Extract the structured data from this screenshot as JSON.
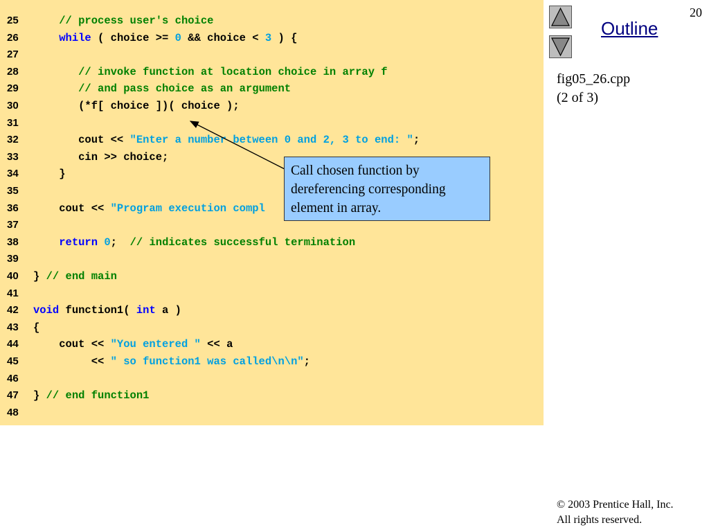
{
  "slide": {
    "page_number": "20",
    "outline_label": "Outline",
    "file_name": "fig05_26.cpp",
    "part": "(2 of 3)",
    "copyright_symbol": "©",
    "copyright_line1": " 2003 Prentice Hall, Inc.",
    "copyright_line2": "All rights reserved.",
    "nav_up_icon": "triangle-up-icon",
    "nav_down_icon": "triangle-down-icon"
  },
  "callout": {
    "text": "Call chosen function by dereferencing corresponding element in array."
  },
  "colors": {
    "code_background": "#ffe599",
    "keyword": "#0000ff",
    "comment": "#008000",
    "string": "#00a0e0",
    "callout_background": "#99ccff",
    "outline_link": "#000080"
  },
  "code_lines": [
    {
      "num": "25",
      "tokens": [
        {
          "t": "    "
        },
        {
          "t": "// process user's choice",
          "c": "cm"
        }
      ]
    },
    {
      "num": "26",
      "tokens": [
        {
          "t": "    "
        },
        {
          "t": "while",
          "c": "kw"
        },
        {
          "t": " ( choice >= "
        },
        {
          "t": "0",
          "c": "num"
        },
        {
          "t": " && choice < "
        },
        {
          "t": "3",
          "c": "num"
        },
        {
          "t": " ) {"
        }
      ]
    },
    {
      "num": "27",
      "tokens": []
    },
    {
      "num": "28",
      "tokens": [
        {
          "t": "       "
        },
        {
          "t": "// invoke function at location choice in array f",
          "c": "cm"
        }
      ]
    },
    {
      "num": "29",
      "tokens": [
        {
          "t": "       "
        },
        {
          "t": "// and pass choice as an argument",
          "c": "cm"
        }
      ]
    },
    {
      "num": "30",
      "tokens": [
        {
          "t": "       (*f[ choice ])( choice );"
        }
      ]
    },
    {
      "num": "31",
      "tokens": []
    },
    {
      "num": "32",
      "tokens": [
        {
          "t": "       cout << "
        },
        {
          "t": "\"Enter a number between 0 and 2, 3 to end: \"",
          "c": "str"
        },
        {
          "t": ";"
        }
      ]
    },
    {
      "num": "33",
      "tokens": [
        {
          "t": "       cin >> choice;"
        }
      ]
    },
    {
      "num": "34",
      "tokens": [
        {
          "t": "    }"
        }
      ]
    },
    {
      "num": "35",
      "tokens": []
    },
    {
      "num": "36",
      "tokens": [
        {
          "t": "    cout << "
        },
        {
          "t": "\"Program execution compl",
          "c": "str"
        }
      ]
    },
    {
      "num": "37",
      "tokens": []
    },
    {
      "num": "38",
      "tokens": [
        {
          "t": "    "
        },
        {
          "t": "return",
          "c": "kw"
        },
        {
          "t": " "
        },
        {
          "t": "0",
          "c": "num"
        },
        {
          "t": ";  "
        },
        {
          "t": "// indicates successful termination",
          "c": "cm"
        }
      ]
    },
    {
      "num": "39",
      "tokens": []
    },
    {
      "num": "40",
      "tokens": [
        {
          "t": "} "
        },
        {
          "t": "// end main",
          "c": "cm"
        }
      ]
    },
    {
      "num": "41",
      "tokens": []
    },
    {
      "num": "42",
      "tokens": [
        {
          "t": "void",
          "c": "kw"
        },
        {
          "t": " function1( "
        },
        {
          "t": "int",
          "c": "kw"
        },
        {
          "t": " a )"
        }
      ]
    },
    {
      "num": "43",
      "tokens": [
        {
          "t": "{"
        }
      ]
    },
    {
      "num": "44",
      "tokens": [
        {
          "t": "    cout << "
        },
        {
          "t": "\"You entered \"",
          "c": "str"
        },
        {
          "t": " << a"
        }
      ]
    },
    {
      "num": "45",
      "tokens": [
        {
          "t": "         << "
        },
        {
          "t": "\" so function1 was called\\n\\n\"",
          "c": "str"
        },
        {
          "t": ";"
        }
      ]
    },
    {
      "num": "46",
      "tokens": []
    },
    {
      "num": "47",
      "tokens": [
        {
          "t": "} "
        },
        {
          "t": "// end function1",
          "c": "cm"
        }
      ]
    },
    {
      "num": "48",
      "tokens": []
    }
  ]
}
